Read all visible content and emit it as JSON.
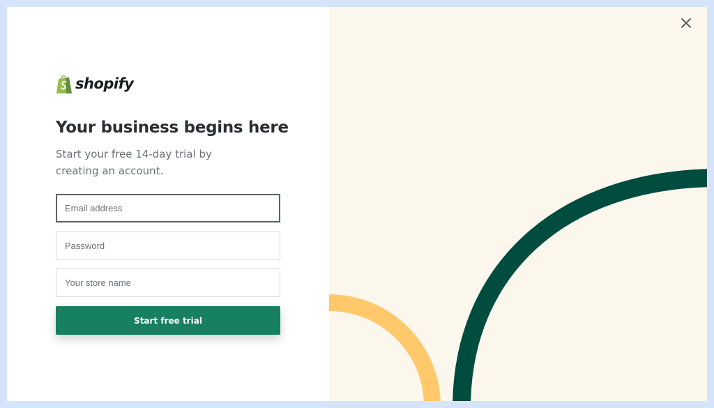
{
  "brand": {
    "name": "shopify",
    "logo_icon": "shopify-bag-icon",
    "icon_color": "#95bf47",
    "icon_color_dark": "#5e8e3e"
  },
  "signup": {
    "title": "Your business begins here",
    "subtitle": "Start your free 14-day trial by creating an account.",
    "fields": {
      "email": {
        "placeholder": "Email address",
        "value": ""
      },
      "password": {
        "placeholder": "Password",
        "value": ""
      },
      "store_name": {
        "placeholder": "Your store name",
        "value": ""
      }
    },
    "submit_label": "Start free trial"
  },
  "close_icon": "close-icon",
  "colors": {
    "primary_button": "#168060",
    "panel_background": "#fbf7ed",
    "arc_yellow": "#ffc96b",
    "arc_green": "#004c3f",
    "page_background": "#d6e4fb"
  }
}
